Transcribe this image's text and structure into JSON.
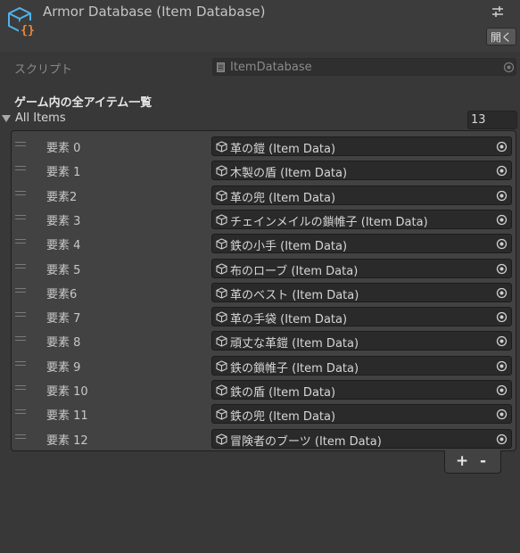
{
  "header": {
    "title": "Armor Database (Item Database)",
    "open_button": "開く",
    "icon": "scriptable-object-icon",
    "settings_icon": "settings-sliders-icon"
  },
  "script_row": {
    "label": "スクリプト",
    "value": "ItemDatabase"
  },
  "section_header": "ゲーム内の全アイテム一覧",
  "list": {
    "label": "All Items",
    "size": "13",
    "items": [
      {
        "label": "要素 0",
        "value": "革の鎧 (Item Data)"
      },
      {
        "label": "要素 1",
        "value": "木製の盾 (Item Data)"
      },
      {
        "label": "要素2",
        "value": "革の兜 (Item Data)"
      },
      {
        "label": "要素 3",
        "value": "チェインメイルの鎖帷子 (Item Data)"
      },
      {
        "label": "要素 4",
        "value": "鉄の小手 (Item Data)"
      },
      {
        "label": "要素 5",
        "value": "布のローブ (Item Data)"
      },
      {
        "label": "要素6",
        "value": "革のベスト (Item Data)"
      },
      {
        "label": "要素 7",
        "value": "革の手袋 (Item Data)"
      },
      {
        "label": "要素 8",
        "value": "頑丈な革鎧 (Item Data)"
      },
      {
        "label": "要素 9",
        "value": "鉄の鎖帷子 (Item Data)"
      },
      {
        "label": "要素 10",
        "value": "鉄の盾 (Item Data)"
      },
      {
        "label": "要素 11",
        "value": "鉄の兜 (Item Data)"
      },
      {
        "label": "要素 12",
        "value": "冒険者のブーツ (Item Data)"
      }
    ],
    "add_label": "+",
    "remove_label": "-"
  },
  "colors": {
    "background": "#383838",
    "icon_blue": "#4fb3ea",
    "icon_orange": "#f08a3a"
  }
}
